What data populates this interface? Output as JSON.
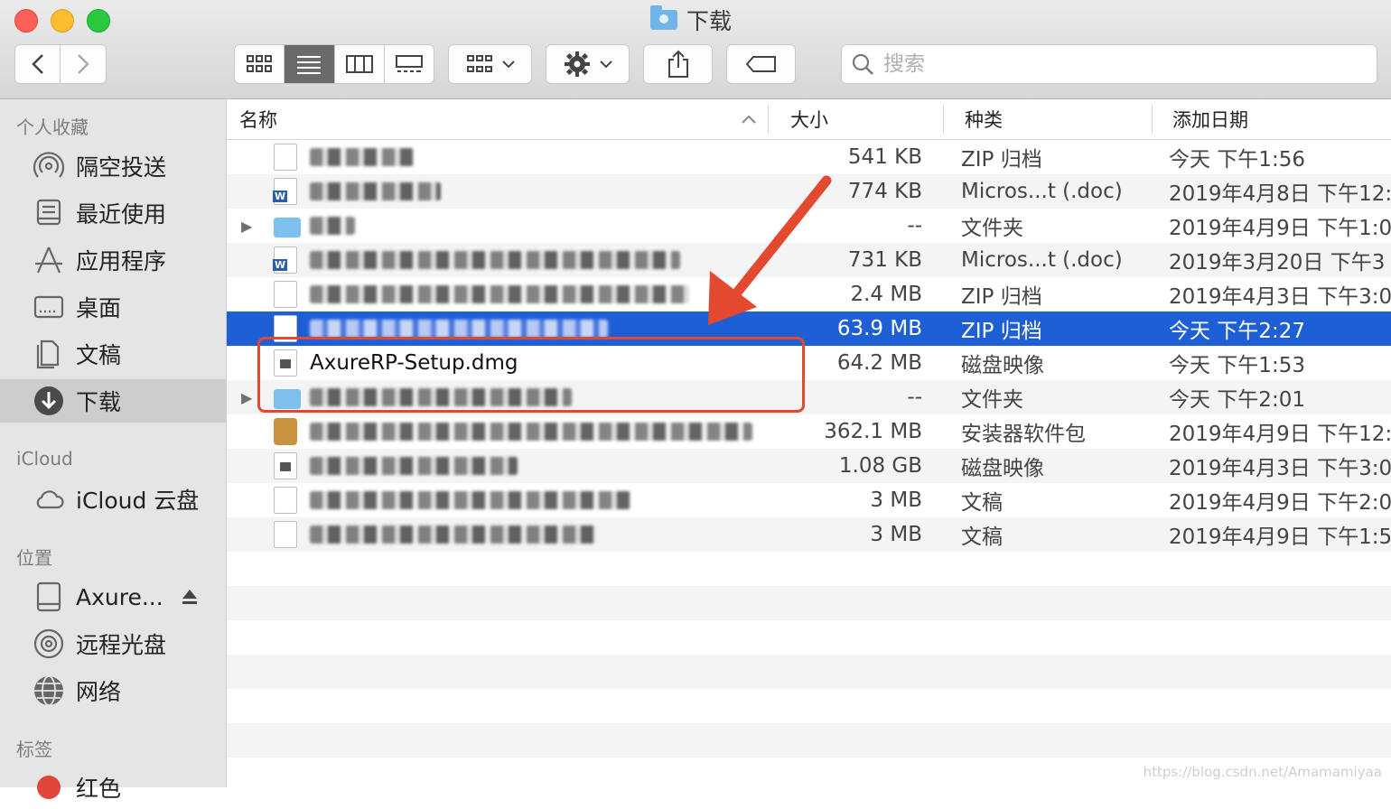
{
  "window": {
    "title": "下载"
  },
  "toolbar": {
    "search_placeholder": "搜索"
  },
  "sidebar": {
    "sections": [
      {
        "label": "个人收藏"
      },
      {
        "label": "iCloud"
      },
      {
        "label": "位置"
      },
      {
        "label": "标签"
      }
    ],
    "favorites": [
      {
        "label": "隔空投送",
        "icon": "airdrop-icon"
      },
      {
        "label": "最近使用",
        "icon": "recents-icon"
      },
      {
        "label": "应用程序",
        "icon": "applications-icon"
      },
      {
        "label": "桌面",
        "icon": "desktop-icon"
      },
      {
        "label": "文稿",
        "icon": "documents-icon"
      },
      {
        "label": "下载",
        "icon": "downloads-icon",
        "selected": true
      }
    ],
    "icloud": [
      {
        "label": "iCloud 云盘",
        "icon": "cloud-icon"
      }
    ],
    "locations": [
      {
        "label": "Axure...",
        "icon": "disk-icon"
      },
      {
        "label": "远程光盘",
        "icon": "optical-disc-icon"
      },
      {
        "label": "网络",
        "icon": "network-icon"
      }
    ],
    "tags": [
      {
        "label": "红色",
        "color": "#e0443a"
      }
    ]
  },
  "columns": {
    "name": "名称",
    "size": "大小",
    "kind": "种类",
    "date": "添加日期"
  },
  "files": [
    {
      "name": "",
      "size": "541 KB",
      "kind": "ZIP 归档",
      "date": "今天 下午1:56",
      "icon": "zip"
    },
    {
      "name": "",
      "size": "774 KB",
      "kind": "Micros...t (.doc)",
      "date": "2019年4月8日 下午12:",
      "icon": "word"
    },
    {
      "name": "",
      "size": "--",
      "kind": "文件夹",
      "date": "2019年4月9日 下午1:0",
      "icon": "folder"
    },
    {
      "name": "",
      "size": "731 KB",
      "kind": "Micros...t (.doc)",
      "date": "2019年3月20日 下午3",
      "icon": "word"
    },
    {
      "name": "",
      "size": "2.4 MB",
      "kind": "ZIP 归档",
      "date": "2019年4月3日 下午3:0",
      "icon": "zip"
    },
    {
      "name": "",
      "size": "63.9 MB",
      "kind": "ZIP 归档",
      "date": "今天 下午2:27",
      "icon": "zip",
      "selected": true
    },
    {
      "name": "AxureRP-Setup.dmg",
      "size": "64.2 MB",
      "kind": "磁盘映像",
      "date": "今天 下午1:53",
      "icon": "dmg"
    },
    {
      "name": "",
      "size": "--",
      "kind": "文件夹",
      "date": "今天 下午2:01",
      "icon": "folder"
    },
    {
      "name": "",
      "size": "362.1 MB",
      "kind": "安装器软件包",
      "date": "2019年4月9日 下午12:",
      "icon": "pkg"
    },
    {
      "name": "",
      "size": "1.08 GB",
      "kind": "磁盘映像",
      "date": "2019年4月3日 下午3:0",
      "icon": "dmg"
    },
    {
      "name": "",
      "size": "3 MB",
      "kind": "文稿",
      "date": "2019年4月9日 下午2:0",
      "icon": "doc"
    },
    {
      "name": "",
      "size": "3 MB",
      "kind": "文稿",
      "date": "2019年4月9日 下午1:5",
      "icon": "doc"
    }
  ],
  "watermark": "https://blog.csdn.net/Amamamiyaa",
  "colors": {
    "selection": "#1f5fd6",
    "annotation": "#e2492f"
  }
}
